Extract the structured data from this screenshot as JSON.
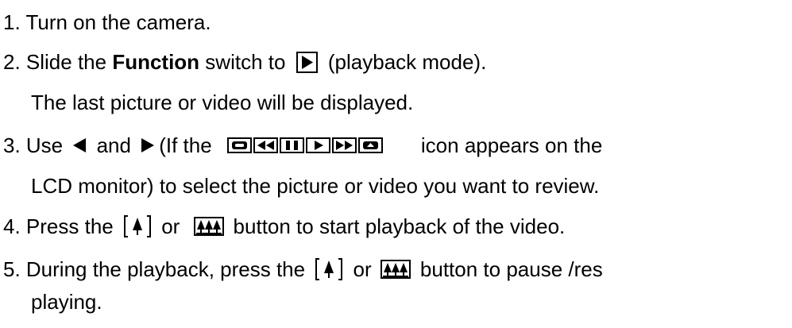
{
  "steps": {
    "s1": {
      "text": "1. Turn on the camera."
    },
    "s2": {
      "prefix": "2. Slide the ",
      "bold": "Function",
      "mid": " switch to ",
      "suffix": " (playback mode)."
    },
    "s2b": {
      "text": "The last picture or video will be displayed."
    },
    "s3": {
      "a": "3. Use ",
      "b": " and ",
      "c": "(If the ",
      "d": "icon appears on the"
    },
    "s3b": {
      "text": "LCD monitor) to select the picture or video you want to review."
    },
    "s4": {
      "a": "4. Press the ",
      "b": " or ",
      "c": "button to start playback of the video."
    },
    "s5": {
      "a": "5. During the playback, press the ",
      "b": " or ",
      "c": "button to pause /res"
    },
    "s5b": {
      "text": "playing."
    }
  },
  "icons": {
    "playback_mode": "play-box-icon",
    "left": "left-triangle-icon",
    "right": "right-triangle-icon",
    "strip": "playback-controls-strip-icon",
    "bracket_tree": "bracketed-tree-button-icon",
    "three_trees": "three-trees-button-icon"
  },
  "colors": {
    "text": "#000000",
    "background": "#ffffff"
  }
}
